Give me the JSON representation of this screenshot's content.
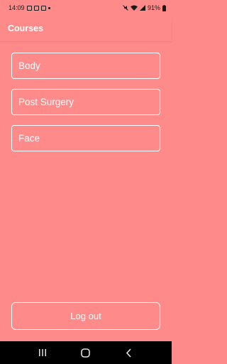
{
  "status_bar": {
    "time": "14:09",
    "battery": "91%",
    "icons": [
      "gallery-icon",
      "message-icon",
      "notification-dot",
      "mute-icon",
      "wifi-icon",
      "signal-icon",
      "battery-icon"
    ]
  },
  "app_bar": {
    "title": "Courses"
  },
  "courses": [
    {
      "label": "Body"
    },
    {
      "label": "Post Surgery"
    },
    {
      "label": "Face"
    }
  ],
  "logout": {
    "label": "Log out"
  },
  "nav": {
    "icons": [
      "recents-icon",
      "home-icon",
      "back-icon"
    ]
  },
  "colors": {
    "background": "#ff8a8a",
    "text": "#ffffff",
    "border": "#ffffff",
    "nav": "#000000"
  }
}
